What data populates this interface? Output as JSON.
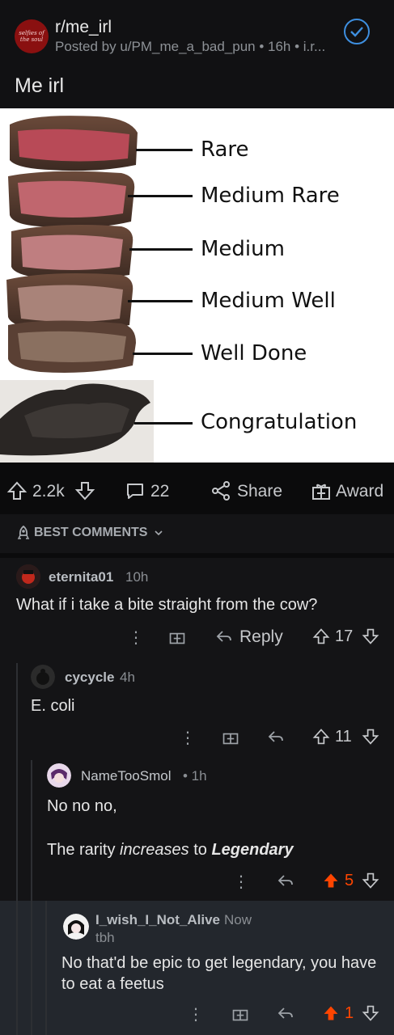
{
  "post": {
    "subreddit": "r/me_irl",
    "avatar_text": "selfies of the soul",
    "posted_by": "Posted by u/PM_me_a_bad_pun • 16h • i.r...",
    "title": "Me irl"
  },
  "image_labels": [
    "Rare",
    "Medium Rare",
    "Medium",
    "Medium Well",
    "Well Done",
    "Congratulation"
  ],
  "actions": {
    "upvotes": "2.2k",
    "comments": "22",
    "share": "Share",
    "award": "Award"
  },
  "sort": {
    "label": "BEST COMMENTS"
  },
  "comments": [
    {
      "user": "eternita01",
      "time": "10h",
      "text": "What if i take a bite straight from the cow?",
      "reply": "Reply",
      "votes": "17"
    },
    {
      "user": "cycycle",
      "time": "4h",
      "text": "E. coli",
      "votes": "11"
    },
    {
      "user": "NameTooSmol",
      "time": "• 1h",
      "text_line1": "No no no,",
      "text_pre": "The rarity ",
      "text_em": "increases",
      "text_mid": " to ",
      "text_strong": "Legendary",
      "votes": "5"
    },
    {
      "user": "I_wish_I_Not_Alive",
      "time": "Now",
      "flair": "tbh",
      "text": "No that'd be epic to get legendary, you have to eat a feetus",
      "votes": "1"
    }
  ],
  "colors": {
    "accent_blue": "#3e8fe0",
    "upvote_orange": "#ff4500",
    "background": "#0b0b0c",
    "highlight": "#23272d"
  }
}
